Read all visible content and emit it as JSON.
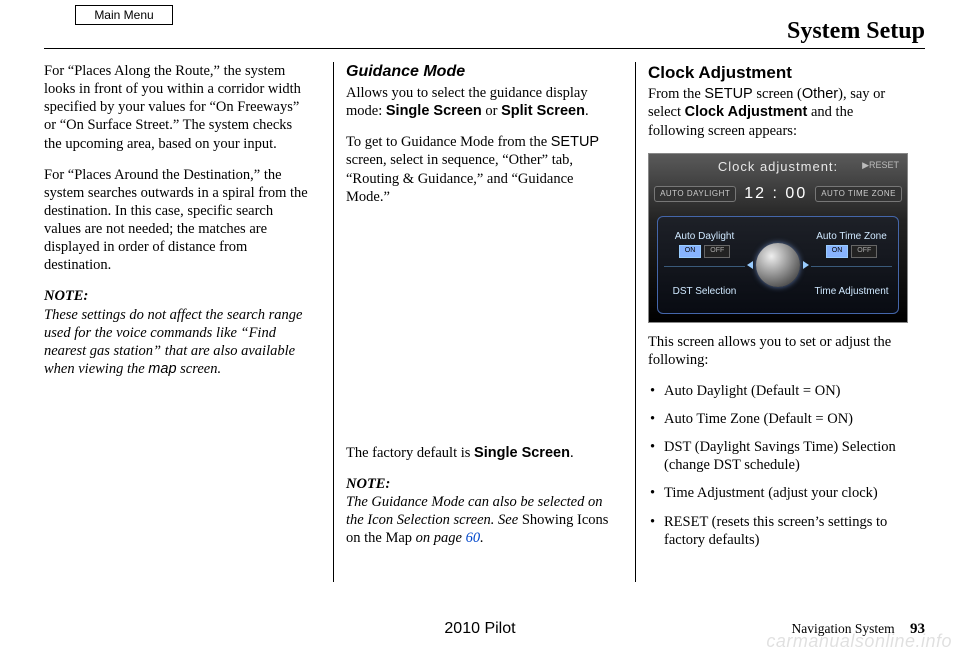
{
  "header": {
    "main_menu": "Main Menu",
    "title": "System Setup"
  },
  "col1": {
    "p1": "For “Places Along the Route,” the system looks in front of you within a corridor width specified by your values for “On Freeways” or “On Surface Street.” The system checks the upcoming area, based on your input.",
    "p2": "For “Places Around the Destination,” the system searches outwards in a spiral from the destination. In this case, specific search values are not needed; the matches are displayed in order of distance from destination.",
    "note_label": "NOTE:",
    "note_body_a": "These settings do not affect the search range used for the voice commands like “Find nearest gas station” that are also available when viewing the ",
    "note_map": "map",
    "note_body_b": " screen."
  },
  "col2": {
    "heading": "Guidance Mode",
    "p1_a": "Allows you to select the guidance display mode: ",
    "p1_b": "Single Screen",
    "p1_c": " or ",
    "p1_d": "Split Screen",
    "p1_e": ".",
    "p2_a": "To get to Guidance Mode from the ",
    "p2_b": "SETUP",
    "p2_c": " screen, select in sequence, “Other” tab, “Routing & Guidance,” and “Guidance Mode.”",
    "p3_a": "The factory default is ",
    "p3_b": "Single Screen",
    "p3_c": ".",
    "note_label": "NOTE:",
    "note_a": "The Guidance Mode can also be selected on the Icon Selection screen. See ",
    "note_b": "Showing Icons on the Map",
    "note_c": " on page ",
    "note_link": "60",
    "note_d": "."
  },
  "col3": {
    "heading": "Clock Adjustment",
    "p1_a": "From the ",
    "p1_b": "SETUP",
    "p1_c": " screen (",
    "p1_d": "Other",
    "p1_e": "), say or select ",
    "p1_f": "Clock Adjustment",
    "p1_g": " and the following screen appears:",
    "screenshot": {
      "title": "Clock adjustment:",
      "reset": "▶RESET",
      "pill_left": "AUTO DAYLIGHT",
      "time": "12 : 00",
      "pill_right": "AUTO TIME ZONE",
      "btn_tl": "Auto Daylight",
      "btn_tr": "Auto Time Zone",
      "btn_bl": "DST Selection",
      "btn_br": "Time Adjustment",
      "on": "ON",
      "off": "OFF"
    },
    "p2": "This screen allows you to set or adjust the following:",
    "bullets": [
      "Auto Daylight (Default = ON)",
      "Auto Time Zone (Default = ON)",
      "DST (Daylight Savings Time) Selection (change DST schedule)",
      "Time Adjustment (adjust your clock)",
      "RESET (resets this screen’s settings to factory defaults)"
    ]
  },
  "footer": {
    "model": "2010 Pilot",
    "section": "Navigation System",
    "page": "93",
    "watermark": "carmanualsonline.info"
  }
}
